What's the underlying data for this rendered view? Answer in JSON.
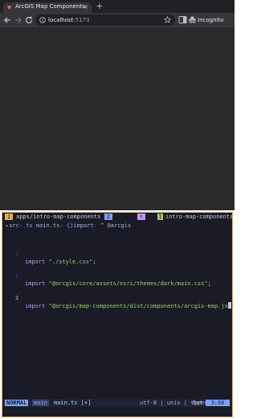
{
  "browser": {
    "tab": {
      "title": "ArcGIS Map Components",
      "close_glyph": "×",
      "favicon": "arcgis-icon"
    },
    "new_tab_glyph": "+",
    "toolbar": {
      "url_host": "localhost",
      "url_port": ":5173",
      "profile_label": "Incognito"
    }
  },
  "editor": {
    "tmux": {
      "window_number": "1",
      "window_name": "apps/intro-map-components",
      "window_count": "2",
      "session_icon": "⬆",
      "session_number": "1",
      "session_name": "intro-map-components"
    },
    "breadcrumb": {
      "folder": "src",
      "file": "main.ts",
      "symbol_type": "{}",
      "symbol": "import",
      "module": "@arcgis"
    },
    "lines": [
      {
        "number": "2",
        "keyword": "import",
        "string": "\"./style.css\"",
        "end": ";"
      },
      {
        "number": "1",
        "keyword": "import",
        "string": "\"@arcgis/core/assets/esri/themes/dark/main.css\"",
        "end": ";"
      },
      {
        "number": "3",
        "keyword": "import",
        "string": "\"@arcgis/map-components/dist/components/arcgis-map.js",
        "end": "\""
      }
    ],
    "statusline": {
      "mode": "NORMAL",
      "branch": "main",
      "file": "main.ts [+]",
      "encoding": "utf-8 | unix | typescript",
      "position": "Bot",
      "cursor": "3:60"
    },
    "colors": {
      "background": "#1a1b26",
      "border": "#e0af68",
      "keyword": "#bb9af7",
      "string": "#9ece6a",
      "mode_bg": "#7aa2f7"
    }
  }
}
